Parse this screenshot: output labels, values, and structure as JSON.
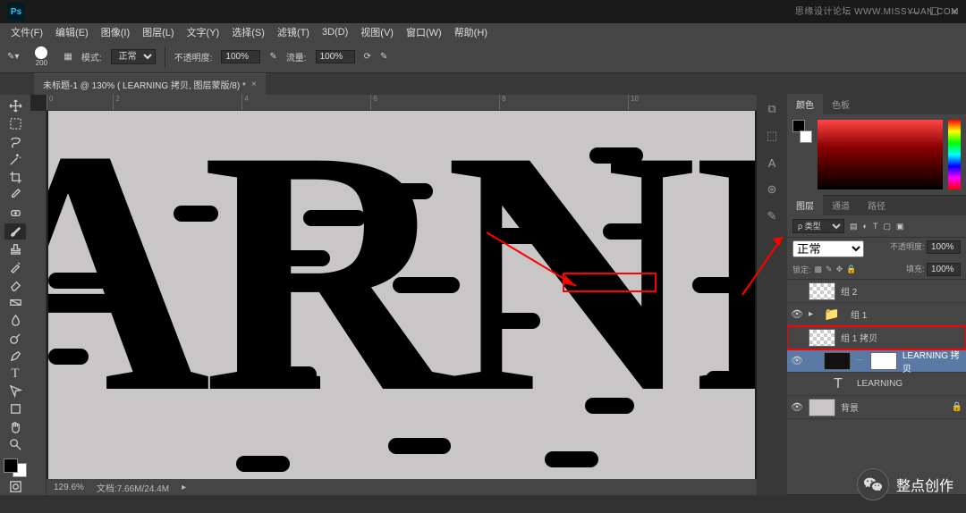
{
  "titlebar": {
    "ps": "Ps"
  },
  "wm_top": "思缘设计论坛 WWW.MISSYUAN.COM",
  "menu": [
    "文件(F)",
    "编辑(E)",
    "图像(I)",
    "图层(L)",
    "文字(Y)",
    "选择(S)",
    "滤镜(T)",
    "3D(D)",
    "视图(V)",
    "窗口(W)",
    "帮助(H)"
  ],
  "options": {
    "brush_size": "200",
    "mode_label": "模式:",
    "mode_value": "正常",
    "opacity_label": "不透明度:",
    "opacity_value": "100%",
    "flow_label": "流量:",
    "flow_value": "100%"
  },
  "doc_tab": {
    "title": "未标题-1 @ 130% ( LEARNING 拷贝, 图层蒙版/8) *",
    "close": "×"
  },
  "ruler_marks": [
    "0",
    "2",
    "4",
    "6",
    "8",
    "10"
  ],
  "artwork_text": "ARNI",
  "status": {
    "zoom": "129.6%",
    "info_label": "文档:",
    "info": "7.66M/24.4M"
  },
  "panels": {
    "color_tabs": [
      "颜色",
      "色板"
    ],
    "layer_tabs": [
      "图层",
      "通道",
      "路径"
    ],
    "kind_label": "ρ 类型",
    "blend_label": "正常",
    "opacity_label": "不透明度:",
    "opacity_val": "100%",
    "lock_label": "锁定:",
    "fill_label": "填充:",
    "fill_val": "100%"
  },
  "layers": [
    {
      "vis": "",
      "thumb": "trans",
      "name": "组 2",
      "indent": 0
    },
    {
      "vis": "👁",
      "thumb": "folder",
      "name": "组 1",
      "indent": 0,
      "arrow": "▸"
    },
    {
      "vis": "",
      "thumb": "trans",
      "name": "组 1 拷贝",
      "indent": 0,
      "hl": true
    },
    {
      "vis": "👁",
      "thumb": "mask",
      "name": "LEARNING 拷贝",
      "indent": 1,
      "sel": true,
      "link": "𝄖"
    },
    {
      "vis": "",
      "thumb": "txt",
      "name": "LEARNING",
      "indent": 1
    },
    {
      "vis": "👁",
      "thumb": "solid",
      "name": "背景",
      "indent": 0,
      "locked": true
    }
  ],
  "watermark": {
    "text": "整点创作"
  }
}
